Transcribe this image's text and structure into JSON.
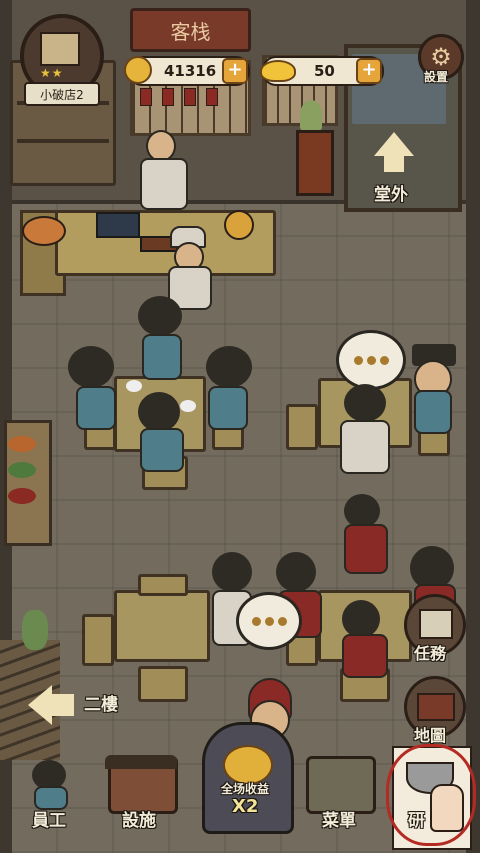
{
  "shop": {
    "name": "小破店2",
    "stars": "★★"
  },
  "resources": {
    "coins": {
      "value": "41316",
      "add_label": "+"
    },
    "gold": {
      "value": "50",
      "add_label": "+"
    }
  },
  "signboard": "客栈",
  "settings": {
    "label": "設置"
  },
  "navigation": {
    "outside": "堂外",
    "upstairs": "二樓"
  },
  "speech_bubbles": [
    "•••",
    "•••"
  ],
  "side_menu": [
    {
      "label": "任務",
      "icon": "scroll-icon"
    },
    {
      "label": "地圖",
      "icon": "map-icon"
    }
  ],
  "bottom_bar": [
    {
      "label": "員工",
      "icon": "staff-icon"
    },
    {
      "label": "設施",
      "icon": "building-icon"
    },
    {
      "label": "全场收益",
      "sub": "X2",
      "icon": "coin-stack-icon"
    },
    {
      "label": "菜單",
      "icon": "menu-icon"
    },
    {
      "label": "研",
      "icon": "research-bowl-icon"
    }
  ]
}
